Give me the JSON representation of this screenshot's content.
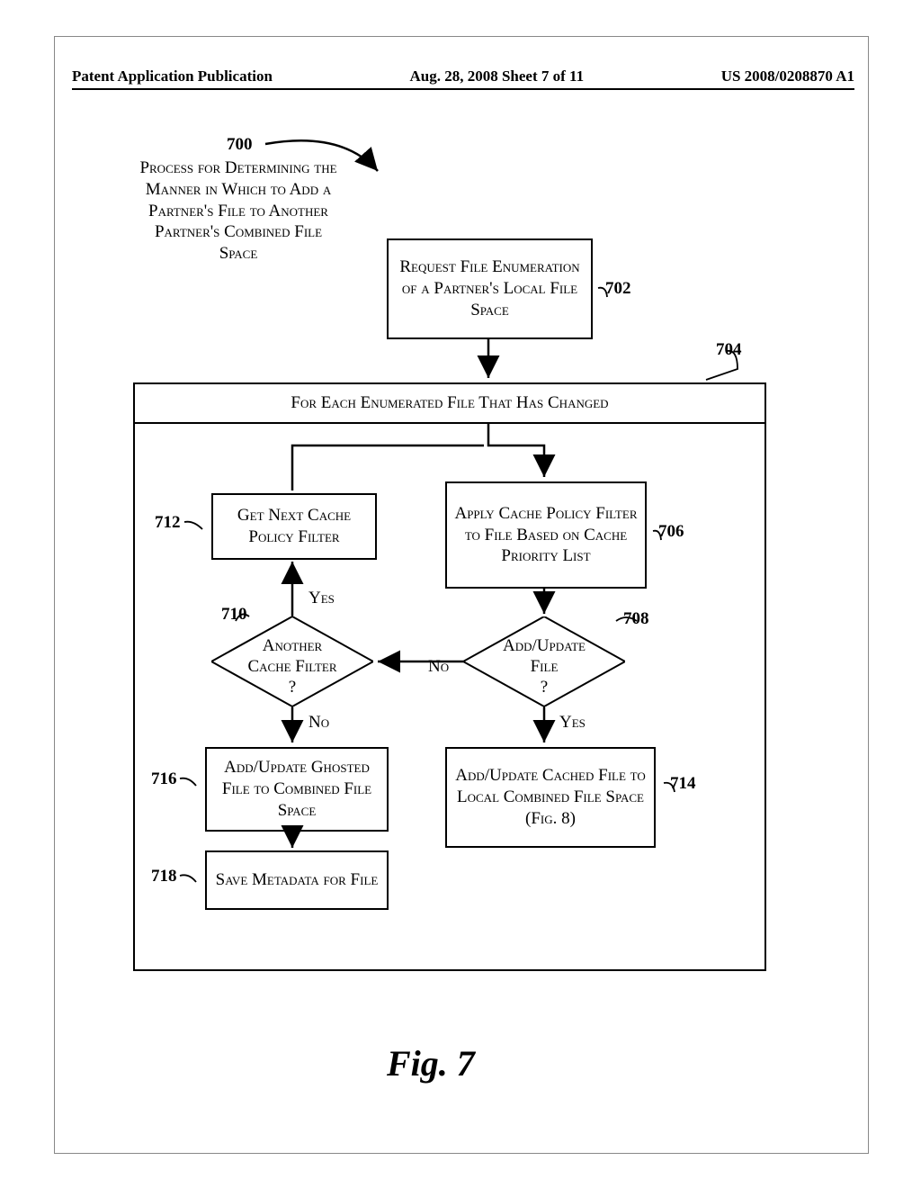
{
  "header": {
    "left": "Patent Application Publication",
    "center": "Aug. 28, 2008  Sheet 7 of 11",
    "right": "US 2008/0208870 A1"
  },
  "title": {
    "ref": "700",
    "text": "Process for Determining the Manner in Which to Add a Partner's File to Another Partner's Combined File Space"
  },
  "boxes": {
    "b702": {
      "ref": "702",
      "text": "Request File Enumeration of a Partner's Local File Space"
    },
    "b704": {
      "ref": "704",
      "text": "For Each Enumerated File That Has Changed"
    },
    "b706": {
      "ref": "706",
      "text": "Apply Cache Policy Filter to File Based on Cache Priority List"
    },
    "b712": {
      "ref": "712",
      "text": "Get Next Cache Policy Filter"
    },
    "b714": {
      "ref": "714",
      "text": "Add/Update Cached File to Local Combined File Space (Fig. 8)"
    },
    "b716": {
      "ref": "716",
      "text": "Add/Update Ghosted File to Combined File Space"
    },
    "b718": {
      "ref": "718",
      "text": "Save Metadata for File"
    }
  },
  "diamonds": {
    "d708": {
      "ref": "708",
      "text": "Add/Update File ?"
    },
    "d710": {
      "ref": "710",
      "text": "Another Cache Filter ?"
    }
  },
  "labels": {
    "yes": "Yes",
    "no": "No"
  },
  "figure": "Fig. 7",
  "chart_data": {
    "type": "flowchart",
    "title": "Process for Determining the Manner in Which to Add a Partner's File to Another Partner's Combined File Space",
    "nodes": [
      {
        "id": "700",
        "type": "title",
        "text": "Process for Determining the Manner in Which to Add a Partner's File to Another Partner's Combined File Space"
      },
      {
        "id": "702",
        "type": "process",
        "text": "Request File Enumeration of a Partner's Local File Space"
      },
      {
        "id": "704",
        "type": "loop-container",
        "text": "For Each Enumerated File That Has Changed"
      },
      {
        "id": "706",
        "type": "process",
        "text": "Apply Cache Policy Filter to File Based on Cache Priority List"
      },
      {
        "id": "708",
        "type": "decision",
        "text": "Add/Update File ?"
      },
      {
        "id": "710",
        "type": "decision",
        "text": "Another Cache Filter ?"
      },
      {
        "id": "712",
        "type": "process",
        "text": "Get Next Cache Policy Filter"
      },
      {
        "id": "714",
        "type": "process",
        "text": "Add/Update Cached File to Local Combined File Space (Fig. 8)"
      },
      {
        "id": "716",
        "type": "process",
        "text": "Add/Update Ghosted File to Combined File Space"
      },
      {
        "id": "718",
        "type": "process",
        "text": "Save Metadata for File"
      }
    ],
    "edges": [
      {
        "from": "702",
        "to": "704"
      },
      {
        "from": "704",
        "to": "706"
      },
      {
        "from": "706",
        "to": "708"
      },
      {
        "from": "708",
        "to": "714",
        "label": "Yes"
      },
      {
        "from": "708",
        "to": "710",
        "label": "No"
      },
      {
        "from": "710",
        "to": "712",
        "label": "Yes"
      },
      {
        "from": "712",
        "to": "706"
      },
      {
        "from": "710",
        "to": "716",
        "label": "No"
      },
      {
        "from": "716",
        "to": "718"
      }
    ]
  }
}
